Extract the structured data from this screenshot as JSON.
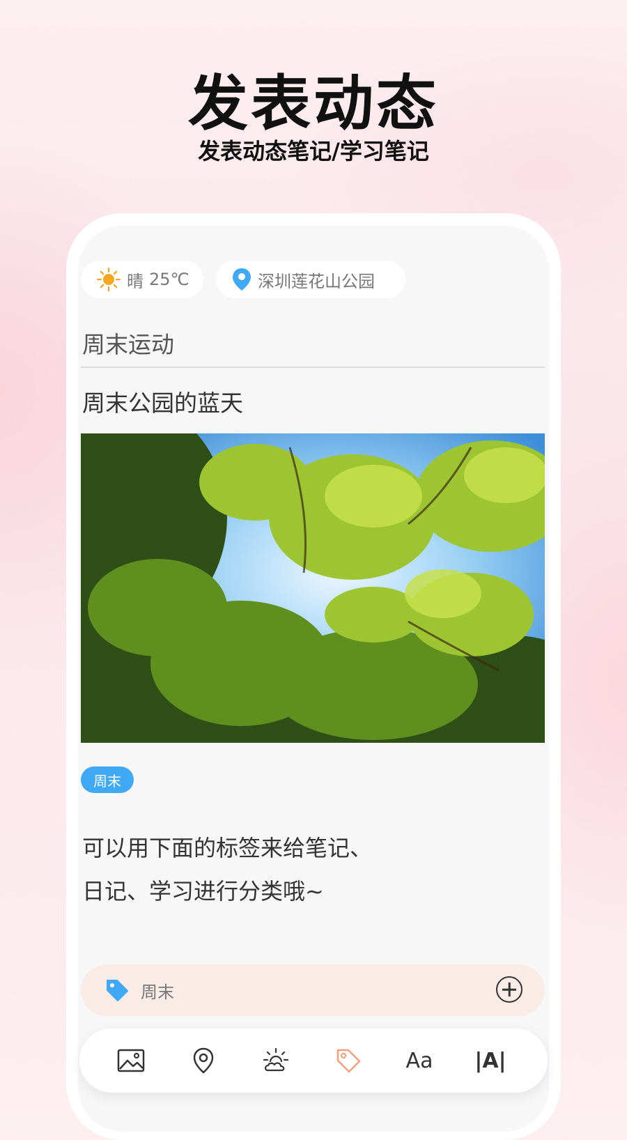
{
  "hero": {
    "title": "发表动态",
    "subtitle": "发表动态笔记/学习笔记"
  },
  "header_chips": {
    "weather_icon": "sun-icon",
    "weather_label": "晴",
    "temperature": "25℃",
    "location_icon": "location-pin-icon",
    "location": "深圳莲花山公园"
  },
  "post": {
    "title": "周末运动",
    "subtitle": "周末公园的蓝天",
    "photo_desc": "looking up at tree canopy against blue sky",
    "tag_badge": "周末",
    "body_line1": "可以用下面的标签来给笔记、",
    "body_line2": "日记、学习进行分类哦~"
  },
  "tag_bar": {
    "icon": "tag-icon",
    "value": "周末",
    "add_icon": "plus-circle-icon"
  },
  "toolbar": {
    "items": [
      {
        "name": "image-icon"
      },
      {
        "name": "location-icon"
      },
      {
        "name": "weather-icon"
      },
      {
        "name": "tag-icon",
        "active": true
      },
      {
        "name": "font-icon",
        "label": "Aa"
      },
      {
        "name": "text-format-icon",
        "label": "|A|"
      }
    ]
  },
  "colors": {
    "accent_blue": "#3fa9f5",
    "tag_active_orange": "#f4a07c",
    "sun_yellow": "#f5a623"
  }
}
